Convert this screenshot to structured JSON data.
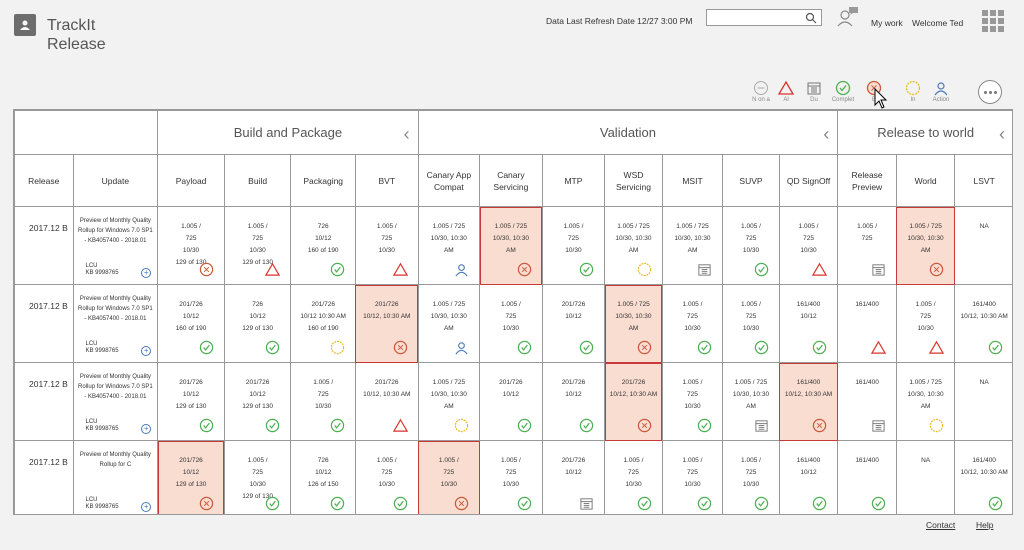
{
  "app": {
    "title_line1": "TrackIt",
    "title_line2": "Release"
  },
  "header": {
    "refresh": "Data Last Refresh Date 12/27  3:00 PM",
    "search_placeholder": "",
    "my_work": "My work",
    "welcome": "Welcome Ted"
  },
  "legend": [
    {
      "icon": "not-on-icon",
      "label": "N on a"
    },
    {
      "icon": "alert-icon",
      "label": "Al"
    },
    {
      "icon": "due-icon",
      "label": "Du"
    },
    {
      "icon": "complete-icon",
      "label": "Complet"
    },
    {
      "icon": "blocked-icon",
      "label": "B"
    },
    {
      "icon": "in-progress-icon",
      "label": "In"
    },
    {
      "icon": "action-icon",
      "label": "Action"
    }
  ],
  "groups": {
    "build": "Build and Package",
    "validation": "Validation",
    "release": "Release to world"
  },
  "columns": [
    "Release",
    "Update",
    "Payload",
    "Build",
    "Packaging",
    "BVT",
    "Canary App Compat",
    "Canary Servicing",
    "MTP",
    "WSD Servicing",
    "MSIT",
    "SUVP",
    "QD SignOff",
    "Release Preview",
    "World",
    "LSVT"
  ],
  "rows": [
    {
      "release": "2017.12 B",
      "update": "Preview of Monthly Quality Rollup for Windows 7.0 SP1 - KB4057400 - 2018.01",
      "kb": "LCU\nKB 9998765",
      "cells": [
        {
          "t": "1.005 /\n725\n10/30\n129 of 130",
          "s": "blocked"
        },
        {
          "t": "1.005 /\n725\n10/30\n129 of 130",
          "s": "alert"
        },
        {
          "t": "726\n10/12\n160 of 190",
          "s": "complete"
        },
        {
          "t": "1.005 /\n725\n10/30",
          "s": "alert"
        },
        {
          "t": "1.005 / 725\n10/30, 10:30\nAM",
          "s": "action"
        },
        {
          "t": "1.005 / 725\n10/30, 10:30\nAM",
          "s": "blocked",
          "h": true
        },
        {
          "t": "1.005 /\n725\n10/30",
          "s": "complete"
        },
        {
          "t": "1.005 / 725\n10/30, 10:30\nAM",
          "s": "progress"
        },
        {
          "t": "1.005 / 725\n10/30, 10:30\nAM",
          "s": "due"
        },
        {
          "t": "1.005 /\n725\n10/30",
          "s": "complete"
        },
        {
          "t": "1.005 /\n725\n10/30",
          "s": "alert"
        },
        {
          "t": "1.005 /\n725",
          "s": "due"
        },
        {
          "t": "1.005 / 725\n10/30, 10:30\nAM",
          "s": "blocked",
          "h": true
        },
        {
          "t": "NA",
          "s": ""
        }
      ]
    },
    {
      "release": "2017.12 B",
      "update": "Preview of Monthly Quality Rollup for Windows 7.0 SP1 - KB4057400 - 2018.01",
      "kb": "LCU\nKB 9998765",
      "cells": [
        {
          "t": "201/726\n10/12\n160 of 190",
          "s": "complete"
        },
        {
          "t": "726\n10/12\n129 of 130",
          "s": "complete"
        },
        {
          "t": "201/726\n10/12 10:30 AM\n160 of 190",
          "s": "progress"
        },
        {
          "t": "201/726\n10/12, 10:30 AM",
          "s": "blocked",
          "h": true
        },
        {
          "t": "1.005 / 725\n10/30, 10:30\nAM",
          "s": "action"
        },
        {
          "t": "1.005 /\n725\n10/30",
          "s": "complete"
        },
        {
          "t": "201/726\n10/12",
          "s": "complete"
        },
        {
          "t": "1.005 / 725\n10/30, 10:30\nAM",
          "s": "blocked",
          "h": true
        },
        {
          "t": "1.005 /\n725\n10/30",
          "s": "complete"
        },
        {
          "t": "1.005 /\n725\n10/30",
          "s": "complete"
        },
        {
          "t": "161/400\n10/12",
          "s": "complete"
        },
        {
          "t": "161/400",
          "s": "alert"
        },
        {
          "t": "1.005 /\n725\n10/30",
          "s": "alert"
        },
        {
          "t": "161/400\n10/12, 10:30 AM",
          "s": "complete"
        }
      ]
    },
    {
      "release": "2017.12 B",
      "update": "Preview of Monthly Quality Rollup for Windows 7.0 SP1 - KB4057400 - 2018.01",
      "kb": "LCU\nKB 9998765",
      "cells": [
        {
          "t": "201/726\n10/12\n129 of 130",
          "s": "complete"
        },
        {
          "t": "201/726\n10/12\n129 of 130",
          "s": "complete"
        },
        {
          "t": "1.005 /\n725\n10/30",
          "s": "complete"
        },
        {
          "t": "201/726\n10/12, 10:30 AM",
          "s": "alert"
        },
        {
          "t": "1.005 / 725\n10/30, 10:30\nAM",
          "s": "progress"
        },
        {
          "t": "201/726\n10/12",
          "s": "complete"
        },
        {
          "t": "201/726\n10/12",
          "s": "complete"
        },
        {
          "t": "201/726\n10/12, 10:30 AM",
          "s": "blocked",
          "h": true
        },
        {
          "t": "1.005 /\n725\n10/30",
          "s": "complete"
        },
        {
          "t": "1.005 / 725\n10/30, 10:30\nAM",
          "s": "due"
        },
        {
          "t": "161/400\n10/12, 10:30 AM",
          "s": "blocked",
          "h": true
        },
        {
          "t": "161/400",
          "s": "due"
        },
        {
          "t": "1.005 / 725\n10/30, 10:30\nAM",
          "s": "progress"
        },
        {
          "t": "NA",
          "s": ""
        }
      ]
    },
    {
      "release": "2017.12 B",
      "update": "Preview of Monthly Quality Rollup for C",
      "kb": "LCU\nKB 9998765",
      "cells": [
        {
          "t": "201/726\n10/12\n129 of 130",
          "s": "blocked",
          "h": true
        },
        {
          "t": "1.005 /\n725\n10/30\n129 of 130",
          "s": "complete"
        },
        {
          "t": "726\n10/12\n126 of 150",
          "s": "complete"
        },
        {
          "t": "1.005 /\n725\n10/30",
          "s": "complete"
        },
        {
          "t": "1.005 /\n725\n10/30",
          "s": "blocked",
          "h": true
        },
        {
          "t": "1.005 /\n725\n10/30",
          "s": "complete"
        },
        {
          "t": "201/726\n10/12",
          "s": "due"
        },
        {
          "t": "1.005 /\n725\n10/30",
          "s": "complete"
        },
        {
          "t": "1.005 /\n725\n10/30",
          "s": "complete"
        },
        {
          "t": "1.005 /\n725\n10/30",
          "s": "complete"
        },
        {
          "t": "161/400\n10/12",
          "s": "complete"
        },
        {
          "t": "161/400",
          "s": "complete"
        },
        {
          "t": "NA",
          "s": ""
        },
        {
          "t": "161/400\n10/12, 10:30 AM",
          "s": "complete"
        }
      ]
    }
  ],
  "footer": {
    "contact": "Contact",
    "help": "Help"
  },
  "colors": {
    "complete": "#4caf50",
    "alert": "#d9342b",
    "progress": "#e8b923",
    "blocked": "#c75a3a",
    "action": "#4a7ab8",
    "due": "#777777",
    "highlight": "#f9ddd0"
  }
}
